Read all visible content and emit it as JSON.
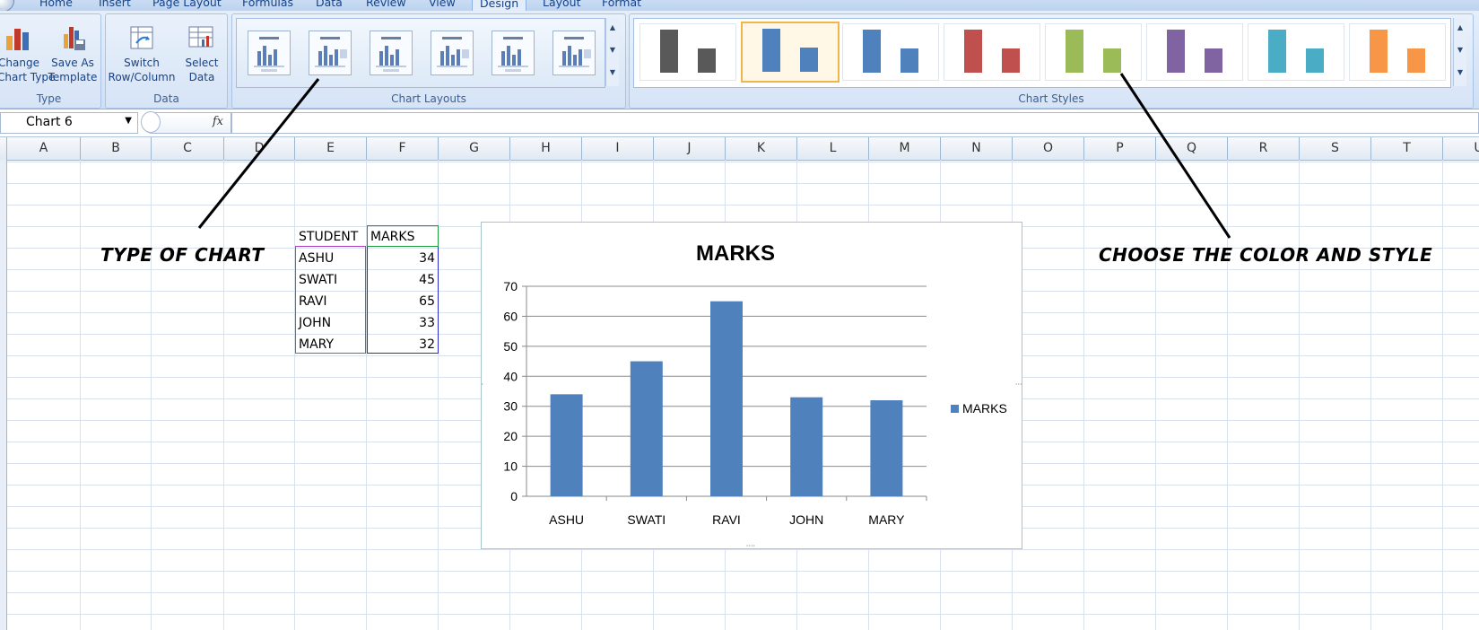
{
  "ribbon": {
    "tabs": [
      "Home",
      "Insert",
      "Page Layout",
      "Formulas",
      "Data",
      "Review",
      "View",
      "Design",
      "Layout",
      "Format"
    ],
    "active_tab": "Design",
    "type_group": {
      "label": "Type",
      "change_chart_type": [
        "Change",
        "Chart Type"
      ],
      "save_as_template": [
        "Save As",
        "Template"
      ]
    },
    "data_group": {
      "label": "Data",
      "switch_row_column": [
        "Switch",
        "Row/Column"
      ],
      "select_data": [
        "Select",
        "Data"
      ]
    },
    "chart_layouts_label": "Chart Layouts",
    "chart_styles_label": "Chart Styles",
    "style_colors": [
      "#595959",
      "#4f81bd",
      "#4f81bd",
      "#c0504d",
      "#9bbb59",
      "#8064a2",
      "#4bacc6",
      "#f79646"
    ]
  },
  "formula_bar": {
    "name_box": "Chart 6",
    "fx": "fx",
    "formula": ""
  },
  "columns": [
    "A",
    "B",
    "C",
    "D",
    "E",
    "F",
    "G",
    "H",
    "I",
    "J",
    "K",
    "L",
    "M",
    "N",
    "O",
    "P",
    "Q",
    "R",
    "S",
    "T",
    "U"
  ],
  "table": {
    "headers": [
      "STUDENT",
      "MARKS"
    ],
    "rows": [
      [
        "ASHU",
        "34"
      ],
      [
        "SWATI",
        "45"
      ],
      [
        "RAVI",
        "65"
      ],
      [
        "JOHN",
        "33"
      ],
      [
        "MARY",
        "32"
      ]
    ]
  },
  "annotations": {
    "left": "TYPE OF CHART",
    "right": "CHOOSE THE COLOR AND STYLE"
  },
  "chart_data": {
    "type": "bar",
    "title": "MARKS",
    "categories": [
      "ASHU",
      "SWATI",
      "RAVI",
      "JOHN",
      "MARY"
    ],
    "series": [
      {
        "name": "MARKS",
        "values": [
          34,
          45,
          65,
          33,
          32
        ]
      }
    ],
    "ylim": [
      0,
      70
    ],
    "yticks": [
      0,
      10,
      20,
      30,
      40,
      50,
      60,
      70
    ],
    "grid": true,
    "legend": "right",
    "color": "#4f81bd"
  }
}
